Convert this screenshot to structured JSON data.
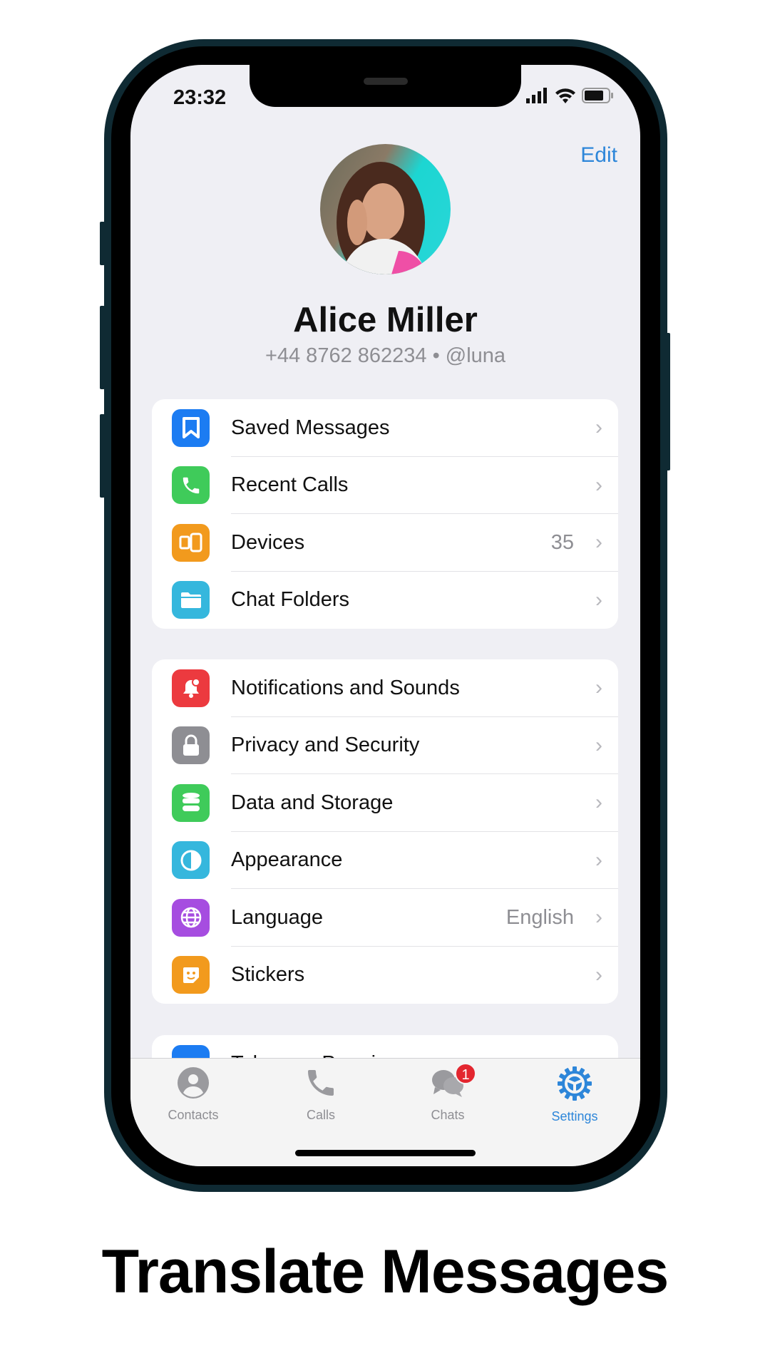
{
  "status_bar": {
    "time": "23:32",
    "icons": [
      "signal-icon",
      "wifi-icon",
      "battery-icon"
    ]
  },
  "header": {
    "edit_label": "Edit"
  },
  "profile": {
    "name": "Alice Miller",
    "subtitle": "+44 8762 862234 • @luna"
  },
  "groups": [
    {
      "items": [
        {
          "label": "Saved Messages",
          "icon": "bookmark-icon",
          "color": "#1c7cf2",
          "value": ""
        },
        {
          "label": "Recent Calls",
          "icon": "phone-icon",
          "color": "#3fcb5a",
          "value": ""
        },
        {
          "label": "Devices",
          "icon": "devices-icon",
          "color": "#f29a1d",
          "value": "35"
        },
        {
          "label": "Chat Folders",
          "icon": "folder-icon",
          "color": "#35b7dd",
          "value": ""
        }
      ]
    },
    {
      "items": [
        {
          "label": "Notifications and Sounds",
          "icon": "bell-icon",
          "color": "#ec3a3f",
          "value": ""
        },
        {
          "label": "Privacy and Security",
          "icon": "lock-icon",
          "color": "#8e8e93",
          "value": ""
        },
        {
          "label": "Data and Storage",
          "icon": "database-icon",
          "color": "#3fcb5a",
          "value": ""
        },
        {
          "label": "Appearance",
          "icon": "half-circle-icon",
          "color": "#35b7dd",
          "value": ""
        },
        {
          "label": "Language",
          "icon": "globe-icon",
          "color": "#a64de0",
          "value": "English"
        },
        {
          "label": "Stickers",
          "icon": "sticker-icon",
          "color": "#f29a1d",
          "value": ""
        }
      ]
    },
    {
      "items": [
        {
          "label": "Telegram Premium",
          "icon": "star-icon",
          "color": "#1c7cf2",
          "value": ""
        }
      ]
    }
  ],
  "tabbar": {
    "items": [
      {
        "label": "Contacts",
        "icon": "person-icon",
        "active": false
      },
      {
        "label": "Calls",
        "icon": "phone-icon",
        "active": false
      },
      {
        "label": "Chats",
        "icon": "chat-bubbles-icon",
        "active": false,
        "badge": "1"
      },
      {
        "label": "Settings",
        "icon": "gear-icon",
        "active": true
      }
    ]
  },
  "colors": {
    "accent": "#2d86d9",
    "badge": "#e3262f",
    "frame": "#0f2a33"
  },
  "headline": "Translate Messages"
}
